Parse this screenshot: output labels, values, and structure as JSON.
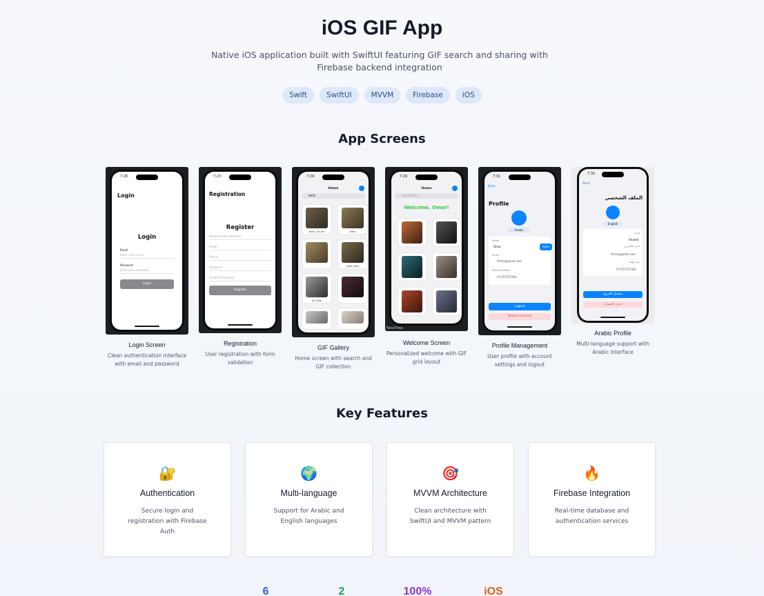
{
  "header": {
    "title": "iOS GIF App",
    "subtitle": "Native iOS application built with SwiftUI featuring GIF search and sharing with Firebase backend integration",
    "tags": [
      "Swift",
      "SwiftUI",
      "MVVM",
      "Firebase",
      "iOS"
    ]
  },
  "screens_section": {
    "title": "App Screens",
    "screens": [
      {
        "label": "Login Screen",
        "description": "Clean authentication interface with email and password"
      },
      {
        "label": "Registration",
        "description": "User registration with form validation"
      },
      {
        "label": "GIF Gallery",
        "description": "Home screen with search and GIF collection"
      },
      {
        "label": "Welcome Screen",
        "description": "Personalized welcome with GIF grid layout"
      },
      {
        "label": "Profile Management",
        "description": "User profile with account settings and logout"
      },
      {
        "label": "Arabic Profile",
        "description": "Multi-language support with Arabic interface"
      }
    ],
    "mock": {
      "login": {
        "time": "7:26",
        "nav": "Login",
        "heading": "Login",
        "email_label": "Email",
        "email_ph": "Enter your e-mail",
        "password_label": "Password",
        "password_ph": "Enter your password",
        "button": "Login"
      },
      "register": {
        "time": "7:23",
        "nav": "Registration",
        "heading": "Register",
        "fields": [
          "Please Enter Full Name",
          "Email",
          "Phone",
          "Password",
          "Confirm Password"
        ],
        "button": "Register"
      },
      "gallery": {
        "time": "7:29",
        "nav": "Home",
        "search": "Hello",
        "captions": [
          "Hello, it's me",
          "Hello",
          "",
          "hello hello",
          "oh hello",
          ""
        ]
      },
      "welcome": {
        "time": "7:29",
        "nav": "Home",
        "search": "Search GIFs",
        "greeting": "Welcome, Omar!",
        "facetime": "FaceTime"
      },
      "profile": {
        "time": "7:31",
        "back": "Back",
        "heading": "Profile",
        "lang": "Arabic",
        "name_label": "Name",
        "name_value": "Omar",
        "save": "Save",
        "email_label": "Email",
        "email_value": "Omar@gmail.com",
        "phone_label": "Phone Number",
        "phone_value": "07155747308",
        "logout": "Logout",
        "delete": "Delete Account"
      },
      "arabic": {
        "time": "7:32",
        "back": "Back",
        "heading": "الملف الشخصي",
        "lang": "English",
        "name_label": "الاسم",
        "name_value": "Khaled",
        "email_label": "البريد الإلكتروني",
        "email_value": "Omar@gmail.com",
        "phone_label": "رقم الهاتف",
        "phone_value": "07155747308",
        "logout": "تسجيل الخروج",
        "delete": "حذف الحساب"
      }
    }
  },
  "features_section": {
    "title": "Key Features",
    "features": [
      {
        "icon": "lock-icon",
        "glyph": "🔐",
        "title": "Authentication",
        "description": "Secure login and registration with Firebase Auth"
      },
      {
        "icon": "globe-icon",
        "glyph": "🌍",
        "title": "Multi-language",
        "description": "Support for Arabic and English languages"
      },
      {
        "icon": "target-icon",
        "glyph": "🎯",
        "title": "MVVM Architecture",
        "description": "Clean architecture with SwiftUI and MVVM pattern"
      },
      {
        "icon": "fire-icon",
        "glyph": "🔥",
        "title": "Firebase Integration",
        "description": "Real-time database and authentication services"
      }
    ]
  },
  "stats": [
    {
      "value": "6",
      "color": "#2f5fc7"
    },
    {
      "value": "2",
      "color": "#1fa05a"
    },
    {
      "value": "100%",
      "color": "#8a35d6"
    },
    {
      "value": "iOS",
      "color": "#e0601f"
    }
  ],
  "colors": {
    "accent": "#2563eb",
    "tag_bg": "#dde8fb",
    "ios_blue": "#0a84ff",
    "green": "#2ecc40",
    "danger_bg": "#fcd9dc"
  }
}
